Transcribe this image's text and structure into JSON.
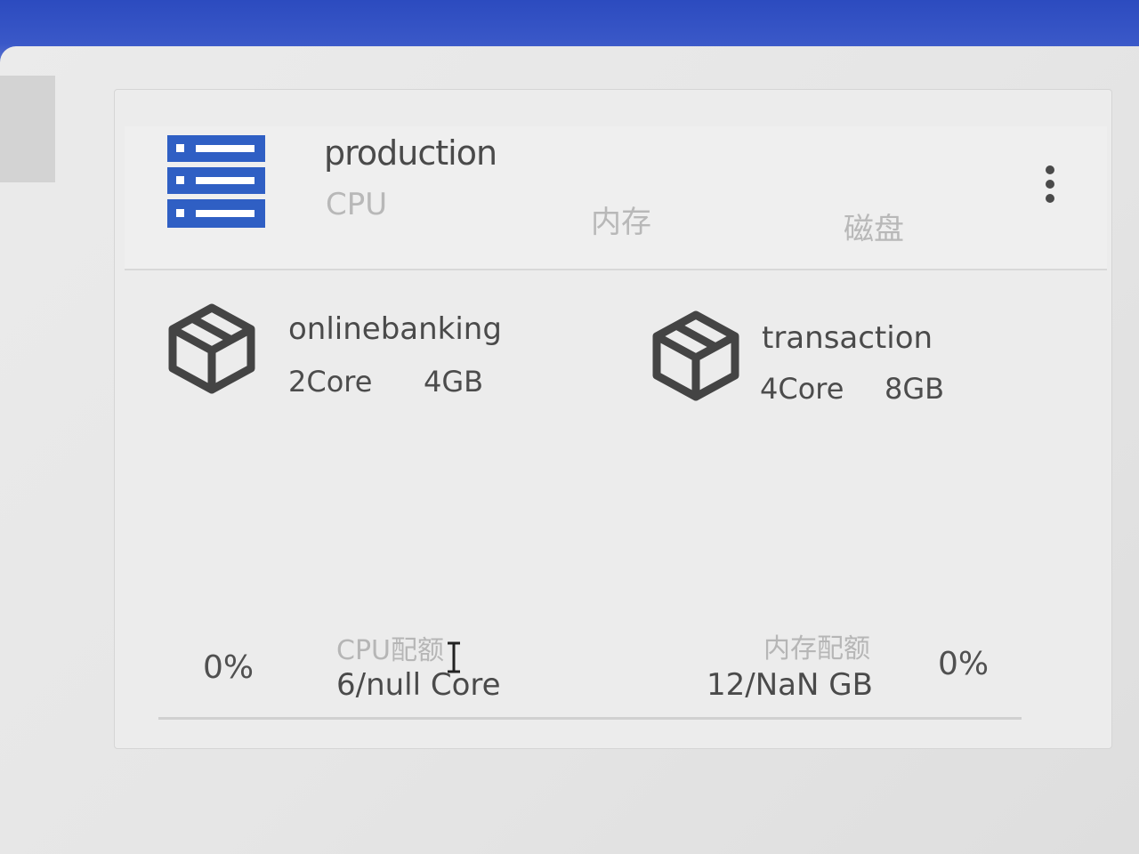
{
  "environment": {
    "header": {
      "title": "production",
      "stats": [
        {
          "label": "CPU"
        },
        {
          "label": "内存"
        },
        {
          "label": "磁盘"
        }
      ]
    },
    "apps": [
      {
        "name": "onlinebanking",
        "cpu": "2Core",
        "memory": "4GB",
        "icon": "cube-icon"
      },
      {
        "name": "transaction",
        "cpu": "4Core",
        "memory": "8GB",
        "icon": "cube-icon"
      }
    ],
    "quota": {
      "cpu": {
        "percent": "0%",
        "label": "CPU配额",
        "value": "6/null Core"
      },
      "memory": {
        "percent": "0%",
        "label": "内存配额",
        "value": "12/NaN GB"
      }
    }
  },
  "icons": {
    "server": "server-stack-icon",
    "more": "more-vertical-icon",
    "cursor": "text-cursor-icon"
  },
  "colors": {
    "topbar": "#2c4bbf",
    "server_icon": "#2f5fc4",
    "text_primary": "#4a4a4a",
    "text_muted": "#b8b8b8"
  }
}
